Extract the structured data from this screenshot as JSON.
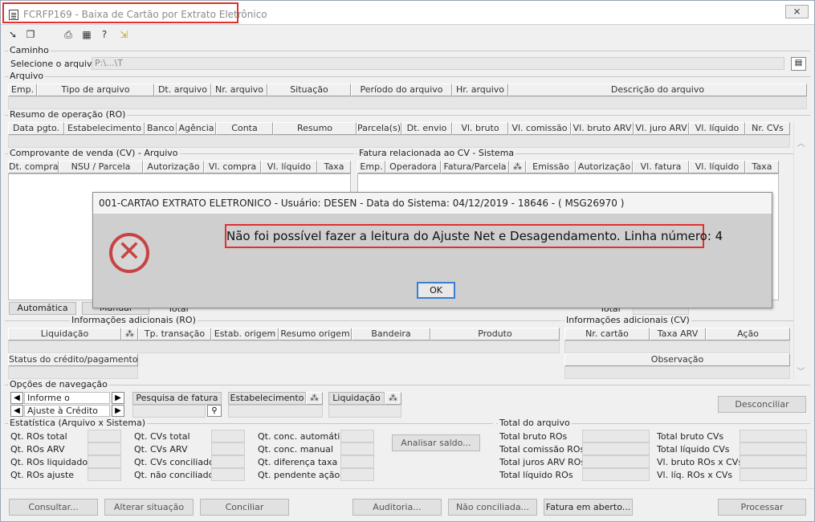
{
  "window": {
    "title": "FCRFP169 - Baixa de Cartão por Extrato Eletrônico",
    "close_symbol": "⨯"
  },
  "toolbar": {
    "icons": [
      "arrow-in-icon",
      "copy-icon",
      "print-icon",
      "calculator-icon",
      "help-icon",
      "exit-icon"
    ]
  },
  "caminho": {
    "section": "Caminho",
    "label": "Selecione o arquivo",
    "path_value": "P:\\...\\T"
  },
  "arquivo": {
    "section": "Arquivo",
    "columns": [
      "Emp.",
      "Tipo de arquivo",
      "Dt. arquivo",
      "Nr. arquivo",
      "Situação",
      "Período do arquivo",
      "Hr. arquivo",
      "Descrição do arquivo"
    ]
  },
  "resumo": {
    "section": "Resumo de operação (RO)",
    "columns": [
      "Data pgto.",
      "Estabelecimento",
      "Banco",
      "Agência",
      "Conta",
      "Resumo",
      "Parcela(s)",
      "Dt. envio",
      "Vl. bruto",
      "Vl. comissão",
      "Vl. bruto ARV",
      "Vl. juro ARV",
      "Vl. líquido",
      "Nr. CVs"
    ]
  },
  "comprovante": {
    "section": "Comprovante de venda (CV) - Arquivo",
    "columns": [
      "Dt. compra",
      "NSU / Parcela",
      "Autorização",
      "Vl. compra",
      "Vl. líquido",
      "Taxa"
    ],
    "btn_auto": "Automática",
    "btn_manual": "Manual",
    "total_label": "Total"
  },
  "fatura": {
    "section": "Fatura relacionada ao CV - Sistema",
    "columns": [
      "Emp.",
      "Operadora",
      "Fatura/Parcela",
      "⁂",
      "Emissão",
      "Autorização",
      "Vl. fatura",
      "Vl. líquido",
      "Taxa"
    ],
    "total_label": "Total"
  },
  "info_ro": {
    "section": "Informações adicionais (RO)",
    "columns": [
      "Liquidação",
      "⁂",
      "Tp. transação",
      "Estab. origem",
      "Resumo origem",
      "Bandeira",
      "Produto"
    ],
    "status_label": "Status do crédito/pagamento"
  },
  "info_cv": {
    "section": "Informações adicionais (CV)",
    "columns": [
      "Nr. cartão",
      "Taxa ARV",
      "Ação"
    ],
    "obs_label": "Observação"
  },
  "navegacao": {
    "section": "Opções de navegação",
    "combo1": "Informe o Resumo!",
    "combo2": "Ajuste à Crédito",
    "btn_pesquisa": "Pesquisa de fatura",
    "btn_estab": "Estabelecimento",
    "btn_liquidacao": "Liquidação",
    "btn_desconciliar": "Desconciliar"
  },
  "estatistica": {
    "section": "Estatística (Arquivo x Sistema)",
    "col1": [
      "Qt. ROs total",
      "Qt. ROs ARV",
      "Qt. ROs liquidados",
      "Qt. ROs ajuste"
    ],
    "col2": [
      "Qt. CVs total",
      "Qt. CVs ARV",
      "Qt. CVs conciliado",
      "Qt. não conciliado"
    ],
    "col3": [
      "Qt. conc. automático",
      "Qt. conc. manual",
      "Qt. diferença taxa",
      "Qt. pendente ação"
    ],
    "btn_analisar": "Analisar saldo..."
  },
  "total": {
    "section": "Total do arquivo",
    "col1": [
      "Total bruto ROs",
      "Total comissão ROs",
      "Total juros ARV ROs",
      "Total líquido ROs"
    ],
    "col2": [
      "Total bruto CVs",
      "Total líquido CVs",
      "Vl. bruto ROs x CVs",
      "Vl. líq. ROs x CVs"
    ]
  },
  "footer": {
    "buttons": [
      "Consultar...",
      "Alterar situação",
      "Conciliar",
      "Auditoria...",
      "Não conciliada...",
      "Fatura em aberto...",
      "Processar"
    ]
  },
  "dialog": {
    "title": "001-CARTAO EXTRATO ELETRONICO - Usuário: DESEN - Data do Sistema: 04/12/2019 - 18646 - ( MSG26970 )",
    "message": "Não foi possível fazer a leitura do Ajuste Net e Desagendamento. Linha número: 4",
    "ok": "OK",
    "error_symbol": "✕"
  },
  "colors": {
    "error": "#c84343",
    "highlight": "#e03030",
    "ok_border": "#3b7fd1"
  }
}
